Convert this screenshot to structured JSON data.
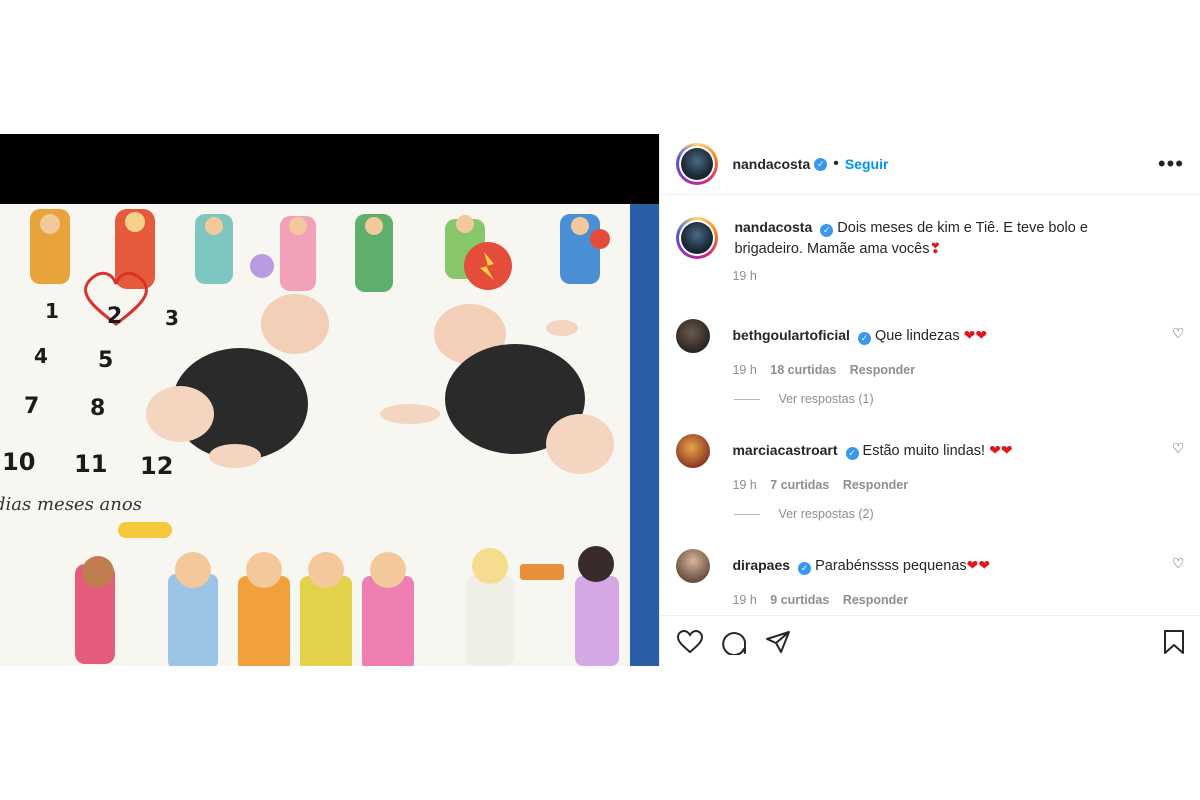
{
  "post": {
    "author": "nandacosta",
    "follow_label": "Seguir",
    "more_icon": "more-icon",
    "caption_user": "nandacosta",
    "caption_text": "Dois meses de kim e Tiê. E teve bolo e brigadeiro. Mamãe ama vocês",
    "caption_emoji": "❣",
    "caption_time": "19 h",
    "photo": {
      "numbers": [
        "1",
        "2",
        "3",
        "4",
        "5",
        "7",
        "8",
        "10",
        "11",
        "12"
      ],
      "script_text": "dias meses anos"
    }
  },
  "comments": [
    {
      "user": "bethgoulartoficial",
      "text": "Que lindezas",
      "emoji": "❤❤",
      "time": "19 h",
      "likes": "18 curtidas",
      "reply": "Responder",
      "view_replies": "Ver respostas (1)"
    },
    {
      "user": "marciacastroart",
      "text": "Estão muito lindas!",
      "emoji": "❤❤",
      "time": "19 h",
      "likes": "7 curtidas",
      "reply": "Responder",
      "view_replies": "Ver respostas (2)"
    },
    {
      "user": "dirapaes",
      "text": "Parabénssss pequenas",
      "emoji": "❤❤",
      "time": "19 h",
      "likes": "9 curtidas",
      "reply": "Responder"
    }
  ],
  "actions": [
    "like-icon",
    "comment-icon",
    "share-icon",
    "save-icon"
  ],
  "colors": {
    "accent": "#0095f6",
    "verified": "#3897f0",
    "heart": "#e0181e",
    "muted": "#8e8e8e"
  }
}
